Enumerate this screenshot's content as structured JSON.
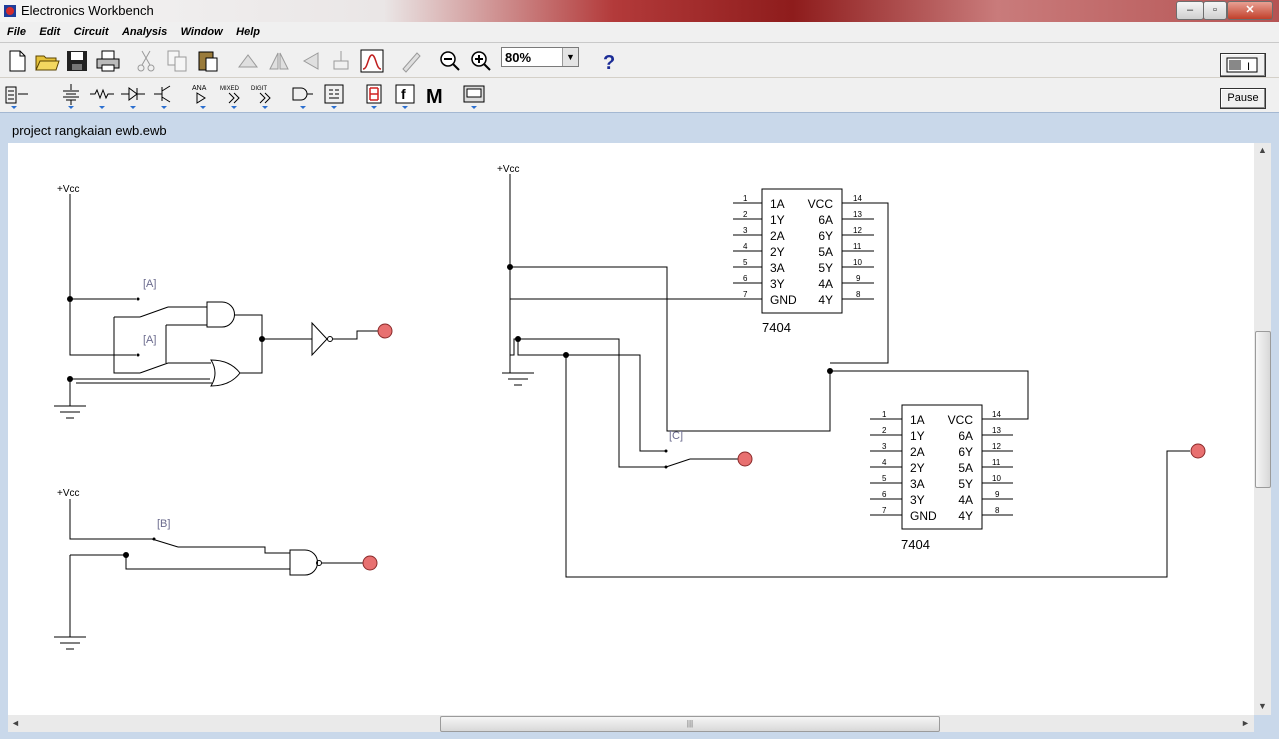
{
  "window": {
    "title": "Electronics Workbench",
    "minimize": "–",
    "maximize": "▫",
    "close": "✕"
  },
  "menu": [
    "File",
    "Edit",
    "Circuit",
    "Analysis",
    "Window",
    "Help"
  ],
  "toolbar": {
    "zoom_value": "80%",
    "zoom_arrow": "▼",
    "help_label": "?",
    "power_label": "I",
    "pause_label": "Pause",
    "parts": {
      "ana": "ANA",
      "mixed": "MIXED",
      "digit": "DIGIT",
      "misc": "M",
      "func": "f"
    }
  },
  "document": {
    "title": "project rangkaian ewb.ewb"
  },
  "scroll": {
    "up": "▲",
    "down": "▼",
    "left": "◄",
    "right": "►",
    "grip": "|||"
  },
  "circuit": {
    "vcc_label": "+Vcc",
    "switch_a": "[A]",
    "switch_b": "[B]",
    "switch_c": "[C]",
    "chip_name": "7404",
    "pins_left": [
      "1A",
      "1Y",
      "2A",
      "2Y",
      "3A",
      "3Y",
      "GND"
    ],
    "pins_right": [
      "VCC",
      "6A",
      "6Y",
      "5A",
      "5Y",
      "4A",
      "4Y"
    ],
    "pin_nums_left": [
      "1",
      "2",
      "3",
      "4",
      "5",
      "6",
      "7"
    ],
    "pin_nums_right": [
      "14",
      "13",
      "12",
      "11",
      "10",
      "9",
      "8"
    ]
  }
}
